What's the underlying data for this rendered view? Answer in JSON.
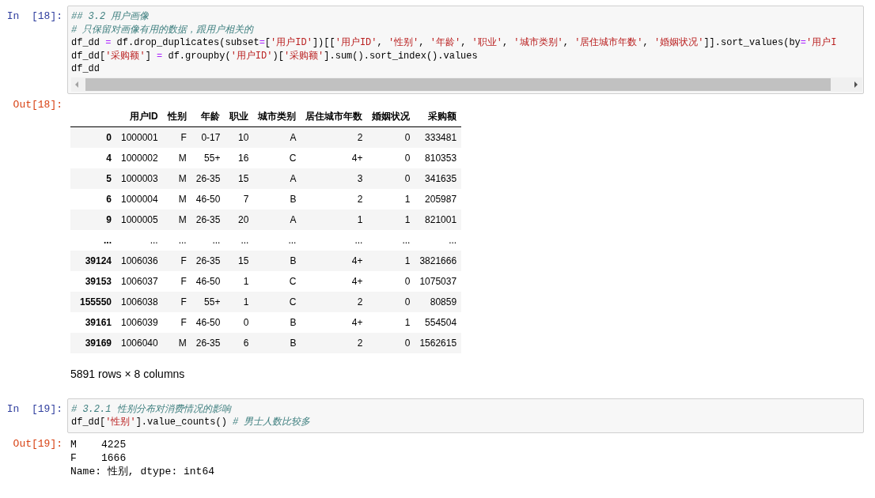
{
  "cells": [
    {
      "prompt": "In  [18]:",
      "lines": [
        [
          {
            "kind": "comment",
            "text": "## 3.2 用户画像"
          }
        ],
        [
          {
            "kind": "comment",
            "text": "# 只保留对画像有用的数据，跟用户相关的"
          }
        ],
        [
          {
            "kind": "plain",
            "text": "df_dd "
          },
          {
            "kind": "op",
            "text": "="
          },
          {
            "kind": "plain",
            "text": " df.drop_duplicates(subset"
          },
          {
            "kind": "op",
            "text": "="
          },
          {
            "kind": "plain",
            "text": "["
          },
          {
            "kind": "string",
            "text": "'用户ID'"
          },
          {
            "kind": "plain",
            "text": "])[["
          },
          {
            "kind": "string",
            "text": "'用户ID'"
          },
          {
            "kind": "plain",
            "text": ", "
          },
          {
            "kind": "string",
            "text": "'性别'"
          },
          {
            "kind": "plain",
            "text": ", "
          },
          {
            "kind": "string",
            "text": "'年龄'"
          },
          {
            "kind": "plain",
            "text": ", "
          },
          {
            "kind": "string",
            "text": "'职业'"
          },
          {
            "kind": "plain",
            "text": ", "
          },
          {
            "kind": "string",
            "text": "'城市类别'"
          },
          {
            "kind": "plain",
            "text": ", "
          },
          {
            "kind": "string",
            "text": "'居住城市年数'"
          },
          {
            "kind": "plain",
            "text": ", "
          },
          {
            "kind": "string",
            "text": "'婚姻状况'"
          },
          {
            "kind": "plain",
            "text": "]].sort_values(by"
          },
          {
            "kind": "op",
            "text": "="
          },
          {
            "kind": "string",
            "text": "'用户I"
          }
        ],
        [
          {
            "kind": "plain",
            "text": "df_dd["
          },
          {
            "kind": "string",
            "text": "'采购额'"
          },
          {
            "kind": "plain",
            "text": "] "
          },
          {
            "kind": "op",
            "text": "="
          },
          {
            "kind": "plain",
            "text": " df.groupby("
          },
          {
            "kind": "string",
            "text": "'用户ID'"
          },
          {
            "kind": "plain",
            "text": ")["
          },
          {
            "kind": "string",
            "text": "'采购额'"
          },
          {
            "kind": "plain",
            "text": "].sum().sort_index().values"
          }
        ],
        [
          {
            "kind": "plain",
            "text": "df_dd"
          }
        ]
      ],
      "output": {
        "prompt": "Out[18]:",
        "kind": "dataframe",
        "columns": [
          "用户ID",
          "性别",
          "年龄",
          "职业",
          "城市类别",
          "居住城市年数",
          "婚姻状况",
          "采购额"
        ],
        "rows": [
          {
            "index": "0",
            "cells": [
              "1000001",
              "F",
              "0-17",
              "10",
              "A",
              "2",
              "0",
              "333481"
            ]
          },
          {
            "index": "4",
            "cells": [
              "1000002",
              "M",
              "55+",
              "16",
              "C",
              "4+",
              "0",
              "810353"
            ]
          },
          {
            "index": "5",
            "cells": [
              "1000003",
              "M",
              "26-35",
              "15",
              "A",
              "3",
              "0",
              "341635"
            ]
          },
          {
            "index": "6",
            "cells": [
              "1000004",
              "M",
              "46-50",
              "7",
              "B",
              "2",
              "1",
              "205987"
            ]
          },
          {
            "index": "9",
            "cells": [
              "1000005",
              "M",
              "26-35",
              "20",
              "A",
              "1",
              "1",
              "821001"
            ]
          },
          {
            "index": "...",
            "cells": [
              "...",
              "...",
              "...",
              "...",
              "...",
              "...",
              "...",
              "..."
            ]
          },
          {
            "index": "39124",
            "cells": [
              "1006036",
              "F",
              "26-35",
              "15",
              "B",
              "4+",
              "1",
              "3821666"
            ]
          },
          {
            "index": "39153",
            "cells": [
              "1006037",
              "F",
              "46-50",
              "1",
              "C",
              "4+",
              "0",
              "1075037"
            ]
          },
          {
            "index": "155550",
            "cells": [
              "1006038",
              "F",
              "55+",
              "1",
              "C",
              "2",
              "0",
              "80859"
            ]
          },
          {
            "index": "39161",
            "cells": [
              "1006039",
              "F",
              "46-50",
              "0",
              "B",
              "4+",
              "1",
              "554504"
            ]
          },
          {
            "index": "39169",
            "cells": [
              "1006040",
              "M",
              "26-35",
              "6",
              "B",
              "2",
              "0",
              "1562615"
            ]
          }
        ],
        "footer": "5891 rows × 8 columns"
      }
    },
    {
      "prompt": "In  [19]:",
      "lines": [
        [
          {
            "kind": "comment",
            "text": "# 3.2.1 性别分布对消费情况的影响"
          }
        ],
        [
          {
            "kind": "plain",
            "text": "df_dd["
          },
          {
            "kind": "string",
            "text": "'性别'"
          },
          {
            "kind": "plain",
            "text": "].value_counts() "
          },
          {
            "kind": "comment",
            "text": "# 男士人数比较多"
          }
        ]
      ],
      "output": {
        "prompt": "Out[19]:",
        "kind": "text",
        "lines": [
          "M    4225",
          "F    1666",
          "Name: 性别, dtype: int64"
        ]
      }
    }
  ]
}
